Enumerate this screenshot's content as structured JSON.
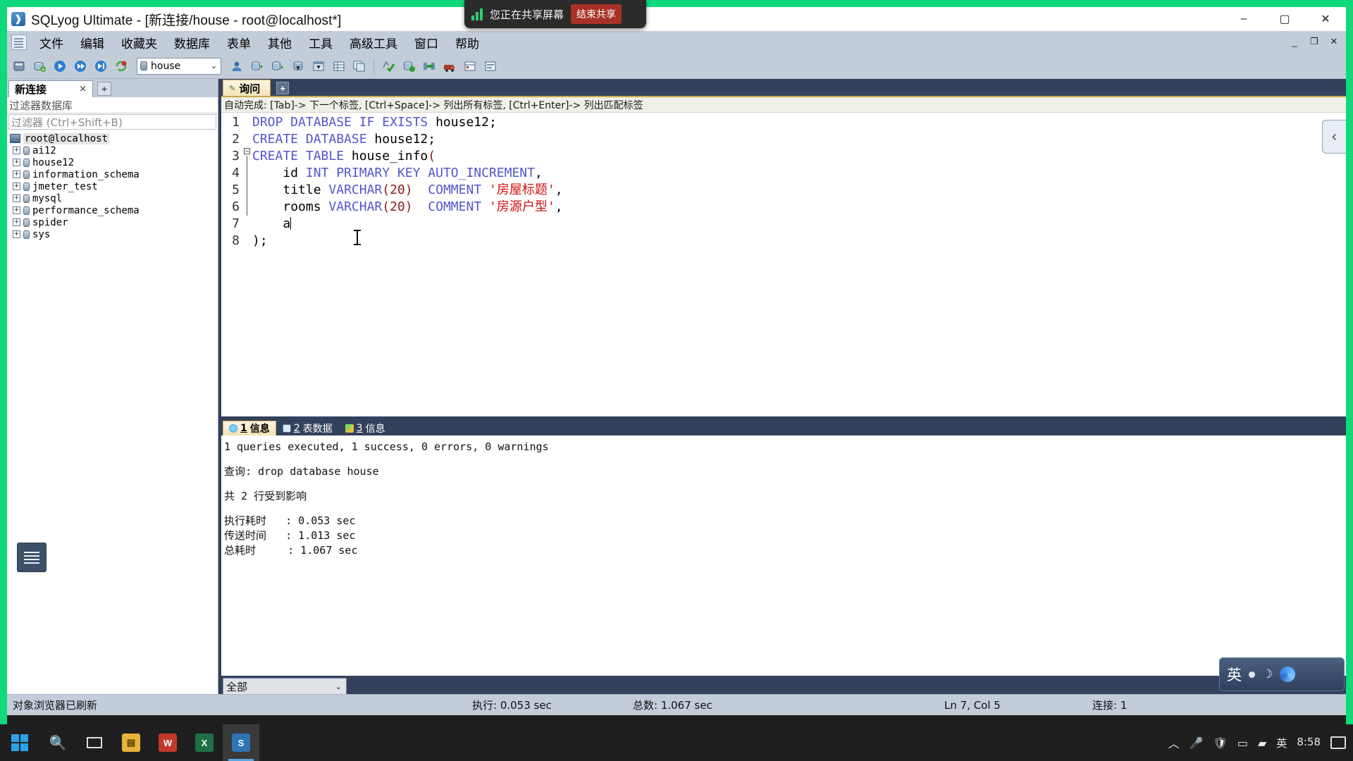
{
  "window": {
    "title": "SQLyog Ultimate - [新连接/house - root@localhost*]",
    "icon": "sqlyog-icon",
    "minimize": "–",
    "maximize": "▢",
    "close": "✕",
    "mdi_minimize": "_",
    "mdi_restore": "❐",
    "mdi_close": "✕"
  },
  "share_banner": {
    "icon": "signal-bars-icon",
    "text": "您正在共享屏幕",
    "stop_label": "结束共享"
  },
  "menubar": {
    "items": [
      "文件",
      "编辑",
      "收藏夹",
      "数据库",
      "表单",
      "其他",
      "工具",
      "高级工具",
      "窗口",
      "帮助"
    ]
  },
  "toolbar": {
    "database_value": "house",
    "buttons": [
      "new-connection-icon",
      "add-connection-icon",
      "execute-query-icon",
      "execute-all-icon",
      "execute-stop-icon",
      "refresh-objects-icon"
    ],
    "buttons_right": [
      "user-manager-icon",
      "import-data-icon",
      "export-data-icon",
      "backup-db-icon",
      "restore-db-icon",
      "table-data-icon",
      "copy-db-icon",
      "sql-check-icon",
      "schema-sync-icon",
      "data-sync-icon",
      "migration-icon",
      "scheduler-icon",
      "grid-view-icon",
      "form-view-icon"
    ]
  },
  "left_panel": {
    "connection_tab": "新连接",
    "connection_tab_close": "×",
    "connection_add": "+",
    "filter_db_label": "过滤器数据库",
    "filter_placeholder": "过滤器 (Ctrl+Shift+B)",
    "tree": {
      "root": "root@localhost",
      "databases": [
        "ai12",
        "house12",
        "information_schema",
        "jmeter_test",
        "mysql",
        "performance_schema",
        "spider",
        "sys"
      ],
      "expander": "+"
    },
    "float_button": "object-browser-toggle"
  },
  "editor": {
    "tab_label": "询问",
    "tab_icon": "query-icon",
    "tab_add": "+",
    "hint": "自动完成: [Tab]-> 下一个标签, [Ctrl+Space]-> 列出所有标签, [Ctrl+Enter]-> 列出匹配标签",
    "edge_chevron": "‹",
    "line_numbers": [
      "1",
      "2",
      "3",
      "4",
      "5",
      "6",
      "7",
      "8"
    ],
    "fold_marker": "−",
    "lines": [
      [
        {
          "t": "DROP DATABASE IF EXISTS ",
          "c": "kw"
        },
        {
          "t": "house12",
          "c": "pl"
        },
        {
          "t": ";",
          "c": "pun"
        }
      ],
      [
        {
          "t": "CREATE DATABASE ",
          "c": "kw"
        },
        {
          "t": "house12",
          "c": "pl"
        },
        {
          "t": ";",
          "c": "pun"
        }
      ],
      [
        {
          "t": "CREATE TABLE ",
          "c": "kw"
        },
        {
          "t": "house_info",
          "c": "pl"
        },
        {
          "t": "(",
          "c": "num"
        }
      ],
      [
        {
          "t": "    ",
          "c": "pl"
        },
        {
          "t": "id ",
          "c": "pl"
        },
        {
          "t": "INT PRIMARY KEY AUTO_INCREMENT",
          "c": "kw"
        },
        {
          "t": ",",
          "c": "pun"
        }
      ],
      [
        {
          "t": "    ",
          "c": "pl"
        },
        {
          "t": "title ",
          "c": "pl"
        },
        {
          "t": "VARCHAR",
          "c": "kw"
        },
        {
          "t": "(20)",
          "c": "num"
        },
        {
          "t": "  ",
          "c": "pl"
        },
        {
          "t": "COMMENT ",
          "c": "kw"
        },
        {
          "t": "'房屋标题'",
          "c": "str"
        },
        {
          "t": ",",
          "c": "pun"
        }
      ],
      [
        {
          "t": "    ",
          "c": "pl"
        },
        {
          "t": "rooms ",
          "c": "pl"
        },
        {
          "t": "VARCHAR",
          "c": "kw"
        },
        {
          "t": "(20)",
          "c": "num"
        },
        {
          "t": "  ",
          "c": "pl"
        },
        {
          "t": "COMMENT ",
          "c": "kw"
        },
        {
          "t": "'房源户型'",
          "c": "str"
        },
        {
          "t": ",",
          "c": "pun"
        }
      ],
      [
        {
          "t": "    ",
          "c": "pl"
        },
        {
          "t": "a",
          "c": "pl"
        }
      ],
      [
        {
          "t": ");",
          "c": "pun"
        }
      ]
    ]
  },
  "results": {
    "tabs": [
      {
        "num": "1",
        "label": "信息",
        "icon": "info-icon",
        "active": true
      },
      {
        "num": "2",
        "label": "表数据",
        "icon": "grid-icon",
        "active": false
      },
      {
        "num": "3",
        "label": "信息",
        "icon": "messages-icon",
        "active": false
      }
    ],
    "output": [
      "1 queries executed, 1 success, 0 errors, 0 warnings",
      "",
      "查询: drop database house",
      "",
      "共 2 行受到影响",
      "",
      "执行耗时   : 0.053 sec",
      "传送时间   : 1.013 sec",
      "总耗时     : 1.067 sec"
    ],
    "filter_select": "全部"
  },
  "statusbar": {
    "message": "对象浏览器已刷新",
    "exec_time": "执行: 0.053 sec",
    "total_time": "总数: 1.067 sec",
    "cursor": "Ln 7, Col 5",
    "connections": "连接: 1"
  },
  "ime": {
    "mode": "英",
    "icons": [
      "dot-icon",
      "moon-icon",
      "flower-icon"
    ]
  },
  "taskbar": {
    "start": "windows-start-icon",
    "search": "search-icon",
    "taskview": "task-view-icon",
    "apps": [
      {
        "name": "file-explorer-icon",
        "glyph": "📁",
        "color": "#e8b33c",
        "active": false
      },
      {
        "name": "wps-icon",
        "glyph": "W",
        "color": "#c0392b",
        "active": false
      },
      {
        "name": "excel-icon",
        "glyph": "X",
        "color": "#1e7145",
        "active": false
      },
      {
        "name": "sqlyog-taskbar-icon",
        "glyph": "S",
        "color": "#2f74b5",
        "active": true
      }
    ],
    "tray": {
      "chevron": "︿",
      "mic": "mic-icon",
      "shield": "security-icon",
      "battery": "battery-icon",
      "network": "network-icon",
      "ime_mode": "英",
      "time": "8:58",
      "notifications": "notification-icon"
    }
  }
}
